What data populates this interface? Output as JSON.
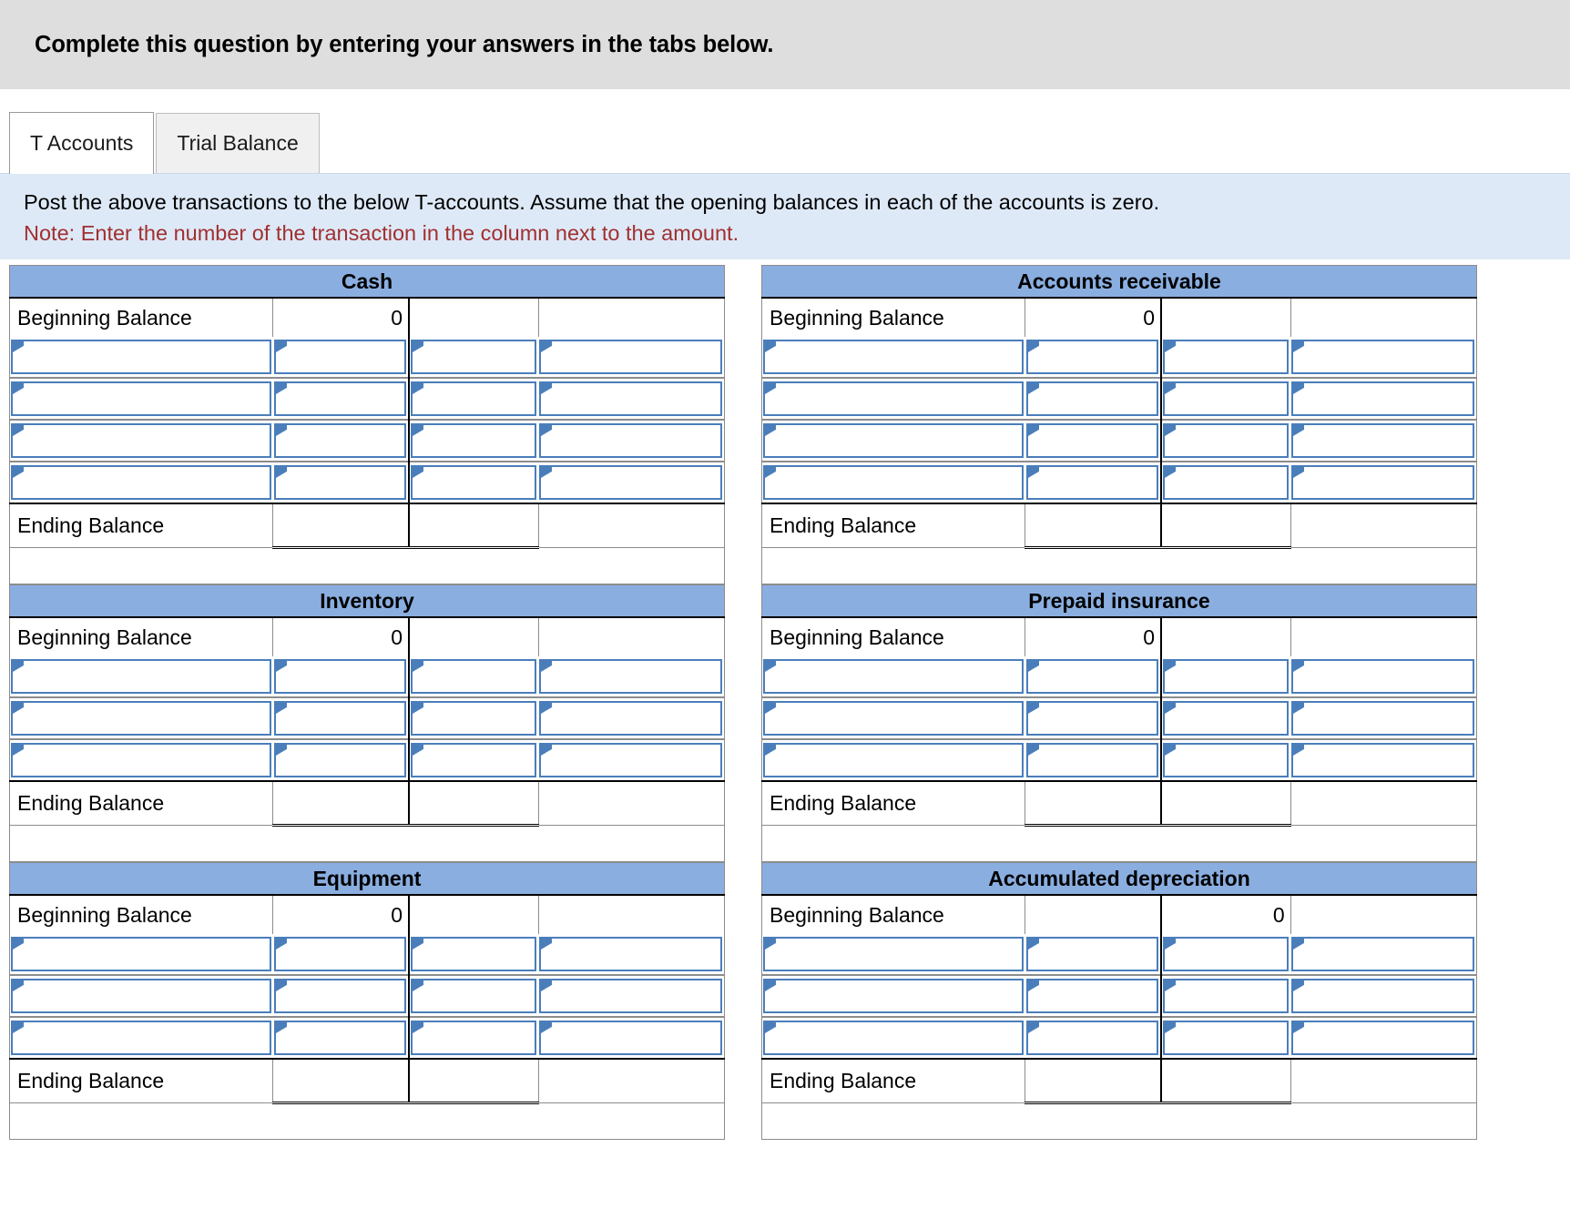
{
  "header": {
    "title": "Complete this question by entering your answers in the tabs below."
  },
  "tabs": [
    {
      "label": "T Accounts",
      "active": true
    },
    {
      "label": "Trial Balance",
      "active": false
    }
  ],
  "instructions": {
    "line1": "Post the above transactions to the below T-accounts. Assume that the opening balances in each of the accounts is zero.",
    "line2": "Note: Enter the number of the transaction in the column next to the amount."
  },
  "labels": {
    "beginning_balance": "Beginning Balance",
    "ending_balance": "Ending Balance"
  },
  "colors": {
    "account_header_blue": "#8AAEE0",
    "instruction_banner": "#DEE9F7",
    "top_banner_grey": "#DEDEDE",
    "input_cell_border": "#4A7EBB",
    "note_red": "#A03030"
  },
  "accounts": {
    "left": [
      {
        "title": "Cash",
        "beginning_balance": {
          "debit": "0",
          "credit": ""
        },
        "input_rows": 4,
        "ending_balance": {
          "debit": "",
          "credit": ""
        }
      },
      {
        "title": "Inventory",
        "beginning_balance": {
          "debit": "0",
          "credit": ""
        },
        "input_rows": 3,
        "ending_balance": {
          "debit": "",
          "credit": ""
        }
      },
      {
        "title": "Equipment",
        "beginning_balance": {
          "debit": "0",
          "credit": ""
        },
        "input_rows": 3,
        "ending_balance": {
          "debit": "",
          "credit": ""
        }
      }
    ],
    "right": [
      {
        "title": "Accounts receivable",
        "beginning_balance": {
          "debit": "0",
          "credit": ""
        },
        "input_rows": 4,
        "ending_balance": {
          "debit": "",
          "credit": ""
        }
      },
      {
        "title": "Prepaid insurance",
        "beginning_balance": {
          "debit": "0",
          "credit": ""
        },
        "input_rows": 3,
        "ending_balance": {
          "debit": "",
          "credit": ""
        }
      },
      {
        "title": "Accumulated depreciation",
        "beginning_balance": {
          "debit": "",
          "credit": "0"
        },
        "input_rows": 3,
        "ending_balance": {
          "debit": "",
          "credit": ""
        }
      }
    ]
  }
}
